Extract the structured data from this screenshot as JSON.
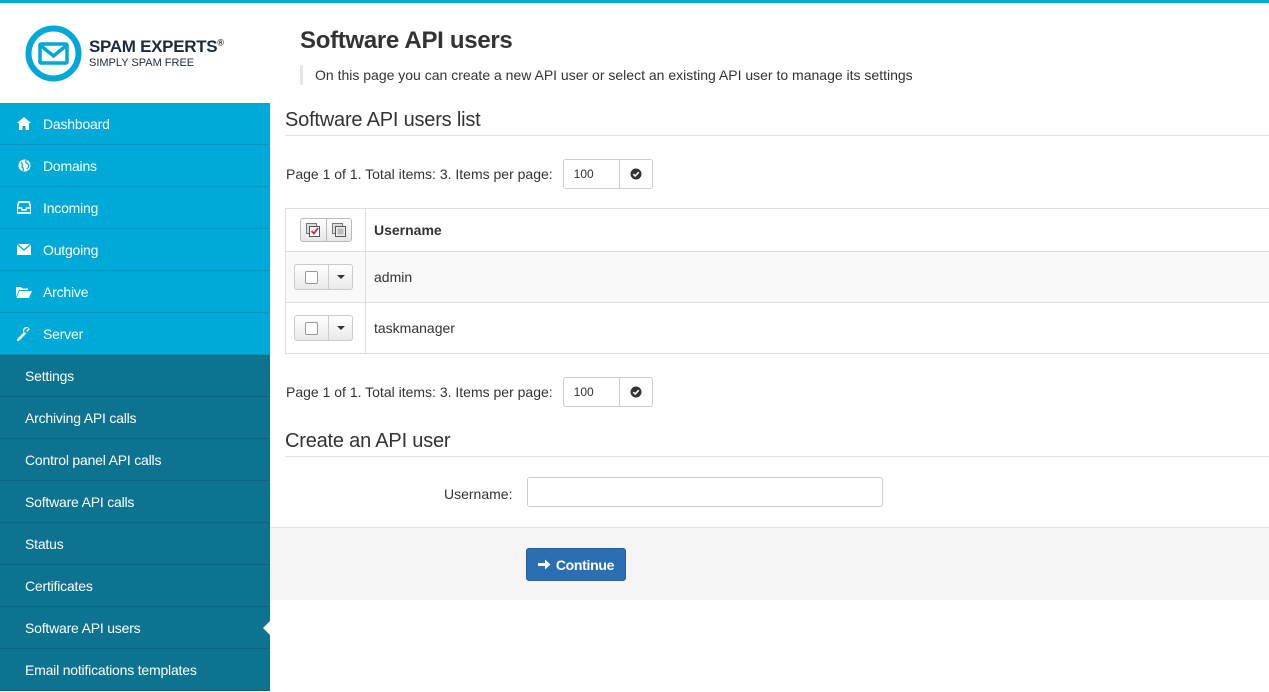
{
  "brand": {
    "name": "SPAM EXPERTS",
    "registered": "®",
    "tagline": "SIMPLY SPAM FREE",
    "color": "#00a8d8"
  },
  "sidebar": {
    "items": [
      {
        "label": "Dashboard",
        "icon": "home-icon"
      },
      {
        "label": "Domains",
        "icon": "globe-icon"
      },
      {
        "label": "Incoming",
        "icon": "inbox-icon"
      },
      {
        "label": "Outgoing",
        "icon": "envelope-icon"
      },
      {
        "label": "Archive",
        "icon": "folder-open-icon"
      },
      {
        "label": "Server",
        "icon": "wrench-icon"
      }
    ],
    "sub_items": [
      {
        "label": "Settings"
      },
      {
        "label": "Archiving API calls"
      },
      {
        "label": "Control panel API calls"
      },
      {
        "label": "Software API calls"
      },
      {
        "label": "Status"
      },
      {
        "label": "Certificates"
      },
      {
        "label": "Software API users",
        "active": true
      },
      {
        "label": "Email notifications templates"
      }
    ]
  },
  "page": {
    "title": "Software API users",
    "description": "On this page you can create a new API user or select an existing API user to manage its settings"
  },
  "list": {
    "heading": "Software API users list",
    "pager_text": "Page 1 of 1. Total items: 3. Items per page:",
    "items_per_page": "100",
    "column_username": "Username",
    "rows": [
      {
        "username": "admin"
      },
      {
        "username": "taskmanager"
      }
    ]
  },
  "create": {
    "heading": "Create an API user",
    "username_label": "Username:",
    "username_value": "",
    "continue_label": "Continue"
  },
  "colors": {
    "nav_primary": "#00aad8",
    "nav_secondary": "#0e7390",
    "button_primary": "#2a6fb2"
  }
}
